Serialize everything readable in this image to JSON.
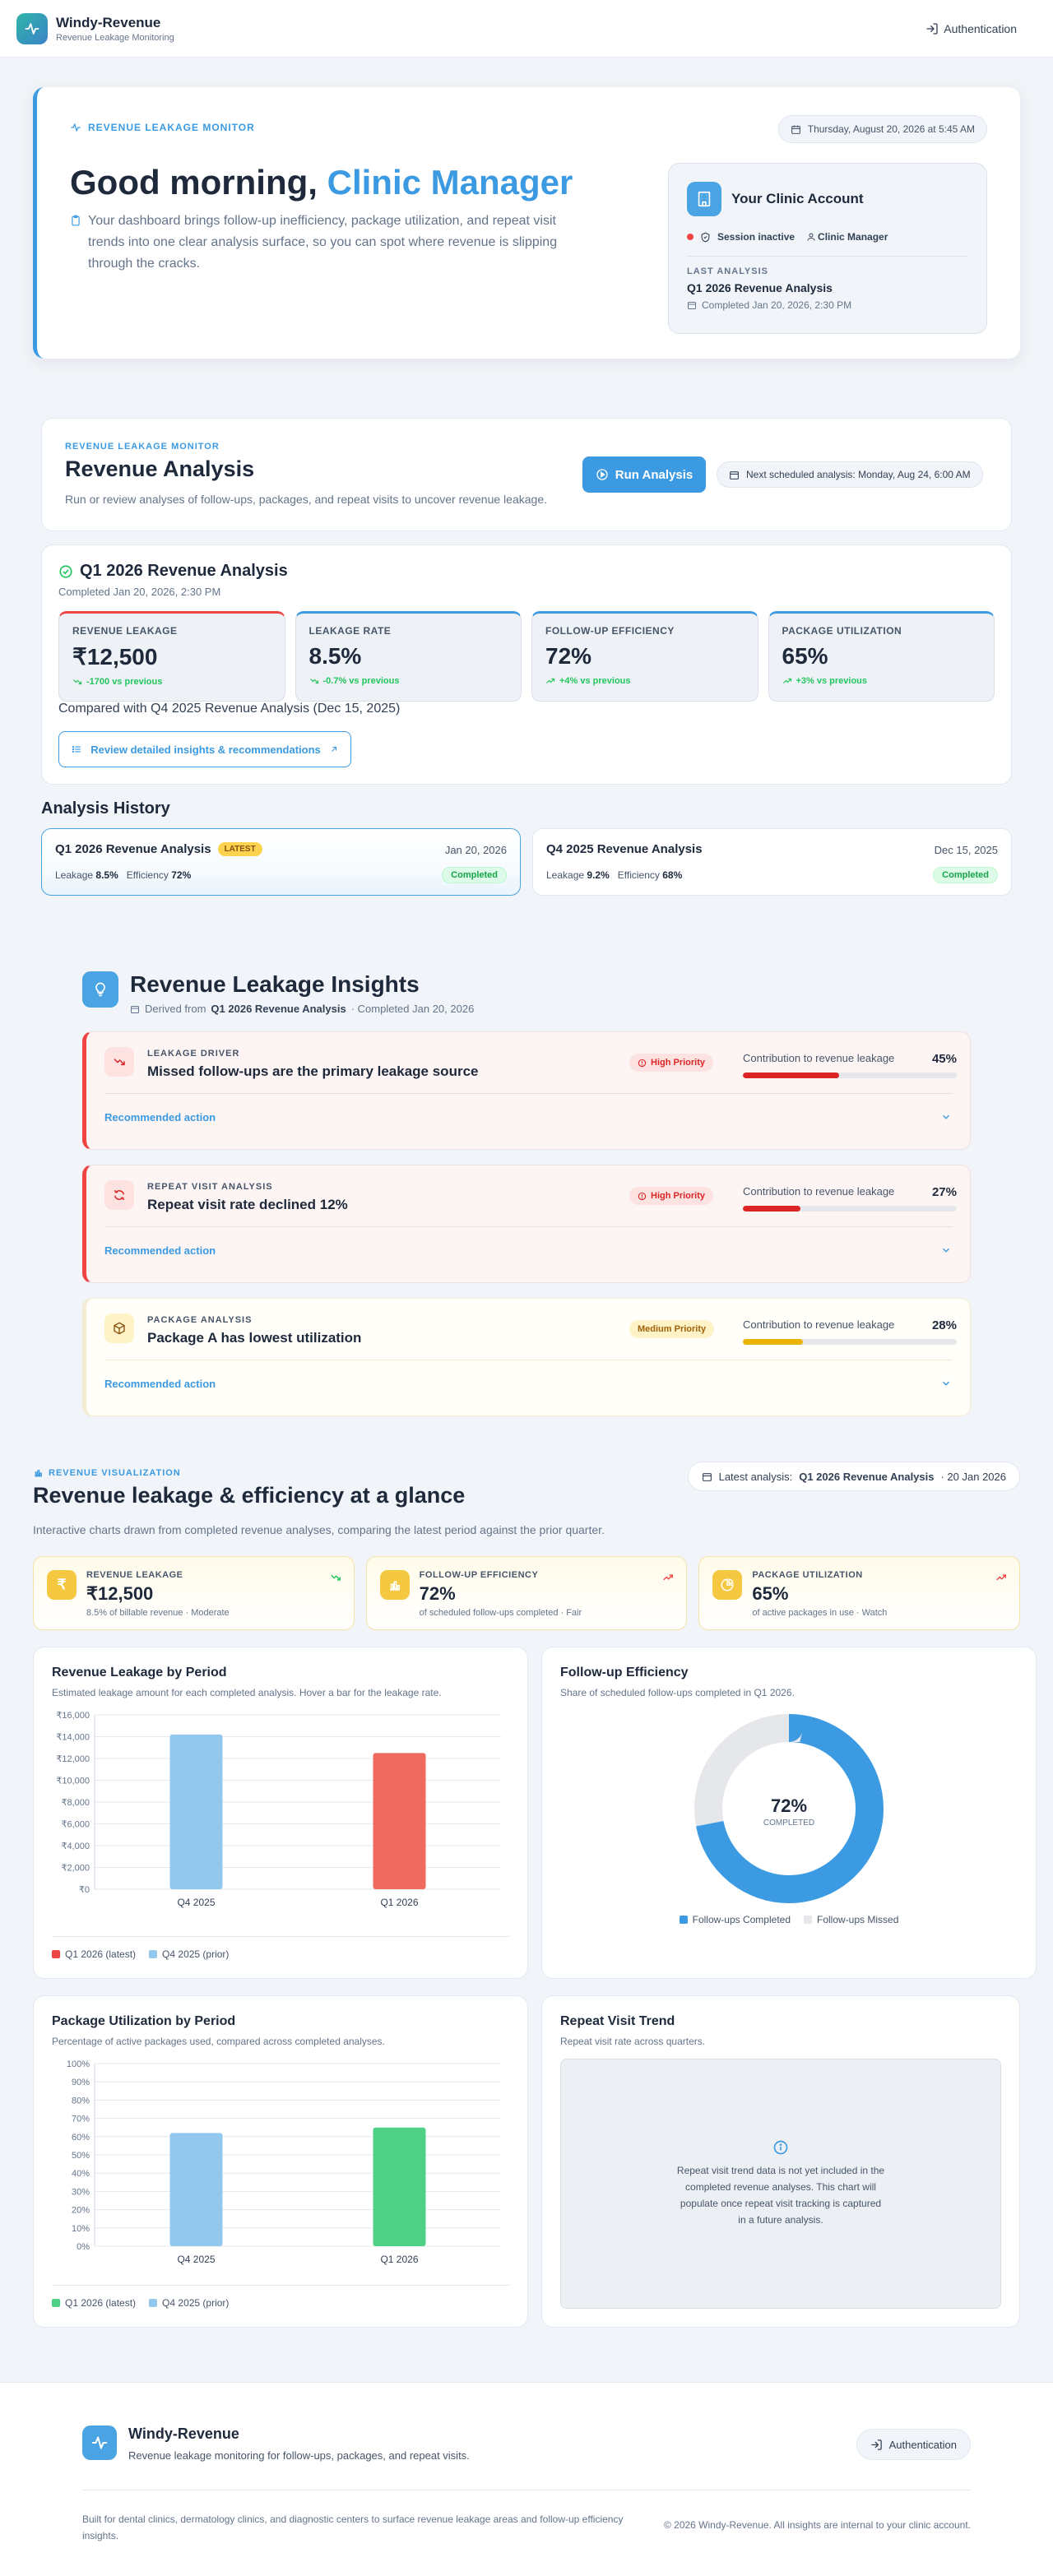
{
  "app": {
    "name": "Windy-Revenue",
    "tagline": "Revenue Leakage Monitoring",
    "auth_label": "Authentication"
  },
  "hero": {
    "kicker": "REVENUE LEAKAGE MONITOR",
    "date": "Thursday, August 20, 2026 at 5:45 AM",
    "greeting": "Good morning,",
    "role": "Clinic Manager",
    "description": "Your dashboard brings follow-up inefficiency, package utilization, and repeat visit trends into one clear analysis surface, so you can spot where revenue is slipping through the cracks.",
    "account": {
      "title": "Your Clinic Account",
      "session": "Session inactive",
      "role": "Clinic Manager",
      "last_label": "LAST ANALYSIS",
      "last_name": "Q1 2026 Revenue Analysis",
      "last_completed": "Completed Jan 20, 2026, 2:30 PM"
    }
  },
  "analysis": {
    "kicker": "REVENUE LEAKAGE MONITOR",
    "title": "Revenue Analysis",
    "description": "Run or review analyses of follow-ups, packages, and repeat visits to uncover revenue leakage.",
    "run_label": "Run Analysis",
    "next_scheduled": "Next scheduled analysis: Monday, Aug 24, 6:00 AM"
  },
  "current": {
    "title": "Q1 2026 Revenue Analysis",
    "completed": "Completed Jan 20, 2026, 2:30 PM",
    "metrics": [
      {
        "label": "REVENUE LEAKAGE",
        "value": "₹12,500",
        "delta": "-1700 vs previous"
      },
      {
        "label": "LEAKAGE RATE",
        "value": "8.5%",
        "delta": "-0.7% vs previous"
      },
      {
        "label": "FOLLOW-UP EFFICIENCY",
        "value": "72%",
        "delta": "+4% vs previous"
      },
      {
        "label": "PACKAGE UTILIZATION",
        "value": "65%",
        "delta": "+3% vs previous"
      }
    ],
    "compared": "Compared with Q4 2025 Revenue Analysis (Dec 15, 2025)",
    "review_label": "Review detailed insights & recommendations"
  },
  "history": {
    "title": "Analysis History",
    "items": [
      {
        "name": "Q1 2026 Revenue Analysis",
        "badge": "LATEST",
        "date": "Jan 20, 2026",
        "leak_label": "Leakage",
        "leak": "8.5%",
        "eff_label": "Efficiency",
        "eff": "72%",
        "status": "Completed"
      },
      {
        "name": "Q4 2025 Revenue Analysis",
        "date": "Dec 15, 2025",
        "leak_label": "Leakage",
        "leak": "9.2%",
        "eff_label": "Efficiency",
        "eff": "68%",
        "status": "Completed"
      }
    ]
  },
  "insights": {
    "title": "Revenue Leakage Insights",
    "derived_prefix": "Derived from",
    "derived_name": "Q1 2026 Revenue Analysis",
    "derived_suffix": "· Completed Jan 20, 2026",
    "contrib_label": "Contribution to revenue leakage",
    "action_label": "Recommended action",
    "items": [
      {
        "kicker": "LEAKAGE DRIVER",
        "title": "Missed follow-ups are the primary leakage source",
        "priority": "High Priority",
        "contribution": "45%",
        "fraction": 0.45
      },
      {
        "kicker": "REPEAT VISIT ANALYSIS",
        "title": "Repeat visit rate declined 12%",
        "priority": "High Priority",
        "contribution": "27%",
        "fraction": 0.27
      },
      {
        "kicker": "PACKAGE ANALYSIS",
        "title": "Package A has lowest utilization",
        "priority": "Medium Priority",
        "contribution": "28%",
        "fraction": 0.28
      }
    ]
  },
  "viz": {
    "kicker": "REVENUE VISUALIZATION",
    "title": "Revenue leakage & efficiency at a glance",
    "description": "Interactive charts drawn from completed revenue analyses, comparing the latest period against the prior quarter.",
    "latest_prefix": "Latest analysis:",
    "latest_name": "Q1 2026 Revenue Analysis",
    "latest_date": "· 20 Jan 2026",
    "kpis": [
      {
        "label": "REVENUE LEAKAGE",
        "value": "₹12,500",
        "note": "8.5% of billable revenue · Moderate",
        "icon": "rupee-icon"
      },
      {
        "label": "FOLLOW-UP EFFICIENCY",
        "value": "72%",
        "note": "of scheduled follow-ups completed · Fair",
        "icon": "bar-chart-icon"
      },
      {
        "label": "PACKAGE UTILIZATION",
        "value": "65%",
        "note": "of active packages in use · Watch",
        "icon": "pie-icon"
      }
    ],
    "colors": {
      "blue": "#3b9ae1",
      "light_blue": "#93c8ee",
      "red": "#ef6a5e",
      "green": "#4ed187",
      "gray": "#e5e7eb"
    }
  },
  "chart_data": [
    {
      "type": "bar",
      "title": "Revenue Leakage by Period",
      "subtitle": "Estimated leakage amount for each completed analysis. Hover a bar for the leakage rate.",
      "categories": [
        "Q4 2025",
        "Q1 2026"
      ],
      "values": [
        14200,
        12500
      ],
      "ylim": [
        0,
        16000
      ],
      "yticks": [
        "₹0",
        "₹2,000",
        "₹4,000",
        "₹6,000",
        "₹8,000",
        "₹10,000",
        "₹12,000",
        "₹14,000",
        "₹16,000"
      ],
      "series": [
        {
          "name": "Q1 2026 (latest)"
        },
        {
          "name": "Q4 2025 (prior)"
        }
      ]
    },
    {
      "type": "pie",
      "title": "Follow-up Efficiency",
      "subtitle": "Share of scheduled follow-ups completed in Q1 2026.",
      "center_value": "72%",
      "center_label": "COMPLETED",
      "slices": [
        {
          "name": "Follow-ups Completed",
          "value": 72
        },
        {
          "name": "Follow-ups Missed",
          "value": 28
        }
      ]
    },
    {
      "type": "bar",
      "title": "Package Utilization by Period",
      "subtitle": "Percentage of active packages used, compared across completed analyses.",
      "categories": [
        "Q4 2025",
        "Q1 2026"
      ],
      "values": [
        62,
        65
      ],
      "ylim": [
        0,
        100
      ],
      "yticks": [
        "0%",
        "10%",
        "20%",
        "30%",
        "40%",
        "50%",
        "60%",
        "70%",
        "80%",
        "90%",
        "100%"
      ],
      "series": [
        {
          "name": "Q1 2026 (latest)"
        },
        {
          "name": "Q4 2025 (prior)"
        }
      ]
    },
    {
      "type": "line",
      "title": "Repeat Visit Trend",
      "subtitle": "Repeat visit rate across quarters.",
      "empty_message": "Repeat visit trend data is not yet included in the completed revenue analyses. This chart will populate once repeat visit tracking is captured in a future analysis."
    }
  ],
  "footer": {
    "name": "Windy-Revenue",
    "tagline": "Revenue leakage monitoring for follow-ups, packages, and repeat visits.",
    "auth_label": "Authentication",
    "built": "Built for dental clinics, dermatology clinics, and diagnostic centers to surface revenue leakage areas and follow-up efficiency insights.",
    "copyright": "© 2026 Windy-Revenue. All insights are internal to your clinic account."
  }
}
